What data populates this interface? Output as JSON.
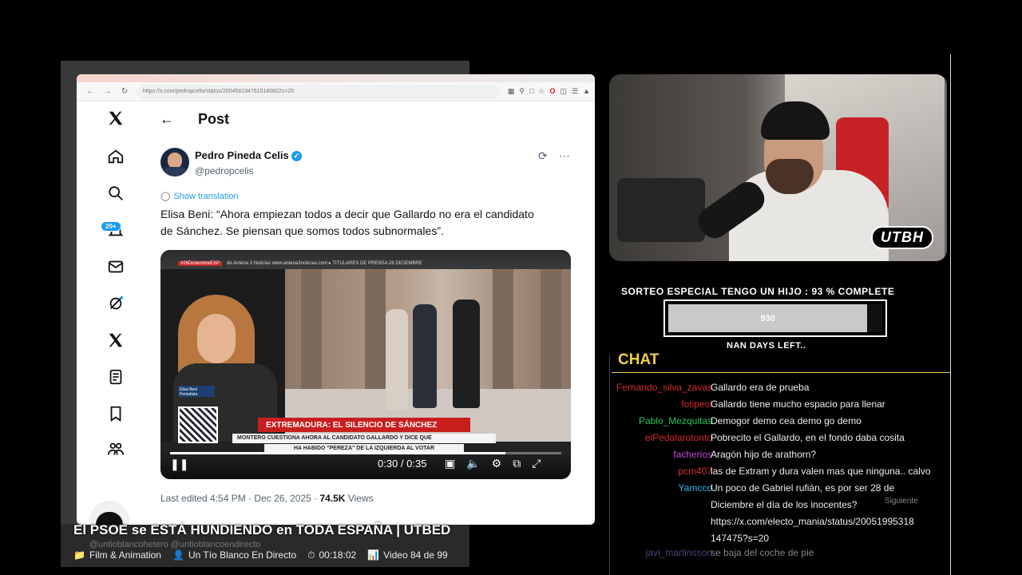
{
  "browser": {
    "url": "https://x.com/pedropcelis/status/2004581947615180822s=20",
    "post_header": "Post",
    "notification_badge": "20+",
    "author_name": "Pedro Pineda Celis",
    "author_handle": "@pedropcelis",
    "translate_label": "Show translation",
    "post_text": "Elisa Beni: “Ahora empiezan todos a decir que Gallardo no era el candidato de Sánchez. Se piensan que somos todos subnormales”.",
    "video": {
      "ticker_tag": "#26DiciembreEXP",
      "ticker_text": "de Antena 3 Noticias  www.antena3noticias.com   ▸  TITULARES DE PRENSA 26 DICIEMBRE",
      "namecard": "Elisa Beni",
      "namecard_role": "Periodista",
      "banner": "EXTREMADURA: EL SILENCIO DE SÁNCHEZ",
      "sub1": "MONTERO CUESTIONA AHORA AL CANDIDATO GALLARDO Y DICE QUE",
      "sub2": "HA HABIDO \"PEREZA\" DE LA IZQUIERDA AL VOTAR",
      "time": "0:30 / 0:35",
      "progress": 0.857
    },
    "edited_label": "Last edited 4:54 PM · Dec 26, 2025 · ",
    "views_count": "74.5K",
    "views_label": " Views"
  },
  "cam": {
    "logo": "UTBH"
  },
  "goal": {
    "title": "SORTEO ESPECIAL TENGO UN HIJO :  93 % COMPLETE",
    "percent": 93,
    "value": "930",
    "days_left": "NAN DAYS LEFT.."
  },
  "chat": {
    "title": "CHAT",
    "messages": [
      {
        "user": "Fernando_silva_zavas",
        "color": "#d42a2a",
        "text": "Gallardo era de prueba"
      },
      {
        "user": "fotipeol",
        "color": "#d42a2a",
        "text": "Gallardo tiene mucho espacio para llenar"
      },
      {
        "user": "Pablo_Mezquitas",
        "color": "#22c35e",
        "text": "Demogor demo cea demo go demo"
      },
      {
        "user": "elPedalarotonto",
        "color": "#d42a2a",
        "text": "Pobrecito el Gallardo, en el fondo daba cosita"
      },
      {
        "user": "facherios",
        "color": "#c44ad8",
        "text": "Aragón hijo de arathorn?"
      },
      {
        "user": "pcm407",
        "color": "#d42a2a",
        "text": "las de Extram y dura valen mas que ninguna.. calvo"
      },
      {
        "user": "Yamcco",
        "color": "#2fb6e8",
        "text": "Un poco de Gabriel rufián, es por ser 28 de"
      },
      {
        "user": "",
        "color": "#eee",
        "text": "Diciembre el día de los inocentes?"
      },
      {
        "user": "",
        "color": "#eee",
        "text": "https://x.com/electo_mania/status/20051995318"
      },
      {
        "user": "",
        "color": "#eee",
        "text": "147475?s=20"
      },
      {
        "user": "javi_martinsson",
        "color": "#8a7fd6",
        "text": "se baja del coche de pie"
      }
    ],
    "next_label": "Siguiente"
  },
  "overlay": {
    "video_title": "El PSOE se ESTÁ HUNDIENDO en TODA ESPAÑA | UTBED",
    "category": "Film & Animation",
    "channel": "Un Tío Blanco En Directo",
    "duration": "00:18:02",
    "playlist": "Video 84 de 99",
    "watermark": "@untioblancohetero     @untioblancoendirecto"
  }
}
